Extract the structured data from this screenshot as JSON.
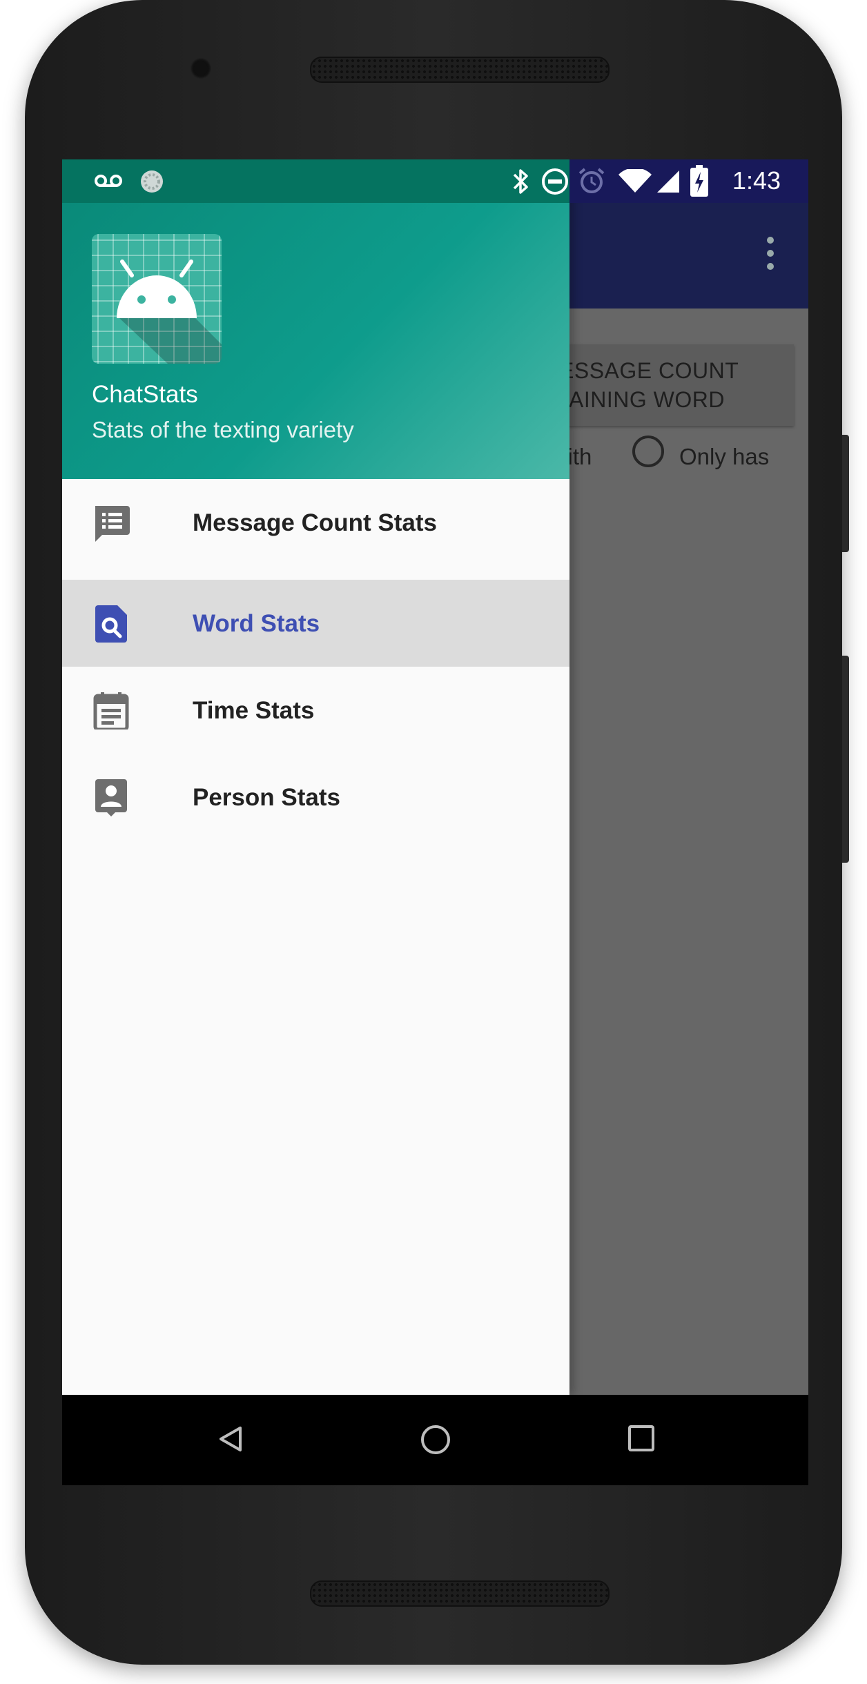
{
  "status_bar": {
    "time": "1:43",
    "icons": [
      "voicemail-icon",
      "sync-icon",
      "bluetooth-icon",
      "do-not-disturb-icon",
      "alarm-icon",
      "wifi-icon",
      "signal-icon",
      "battery-charging-icon"
    ]
  },
  "drawer": {
    "header": {
      "app_name": "ChatStats",
      "subtitle": "Stats of the texting variety"
    },
    "items": [
      {
        "label": "Message Count Stats",
        "icon": "message-list-icon",
        "selected": false
      },
      {
        "label": "Word Stats",
        "icon": "find-in-page-icon",
        "selected": true
      },
      {
        "label": "Time Stats",
        "icon": "calendar-icon",
        "selected": false
      },
      {
        "label": "Person Stats",
        "icon": "contact-icon",
        "selected": false
      }
    ]
  },
  "background_screen": {
    "button_line1": "ESSAGE COUNT",
    "button_line2": "AINING WORD",
    "radio_left_label": "vith",
    "radio_right_label": "Only has"
  },
  "colors": {
    "drawer_header": "#0e9c8c",
    "selected_text": "#3e4fb3",
    "app_bar": "#1a2050"
  },
  "system_nav": [
    "back-icon",
    "home-icon",
    "recents-icon"
  ]
}
